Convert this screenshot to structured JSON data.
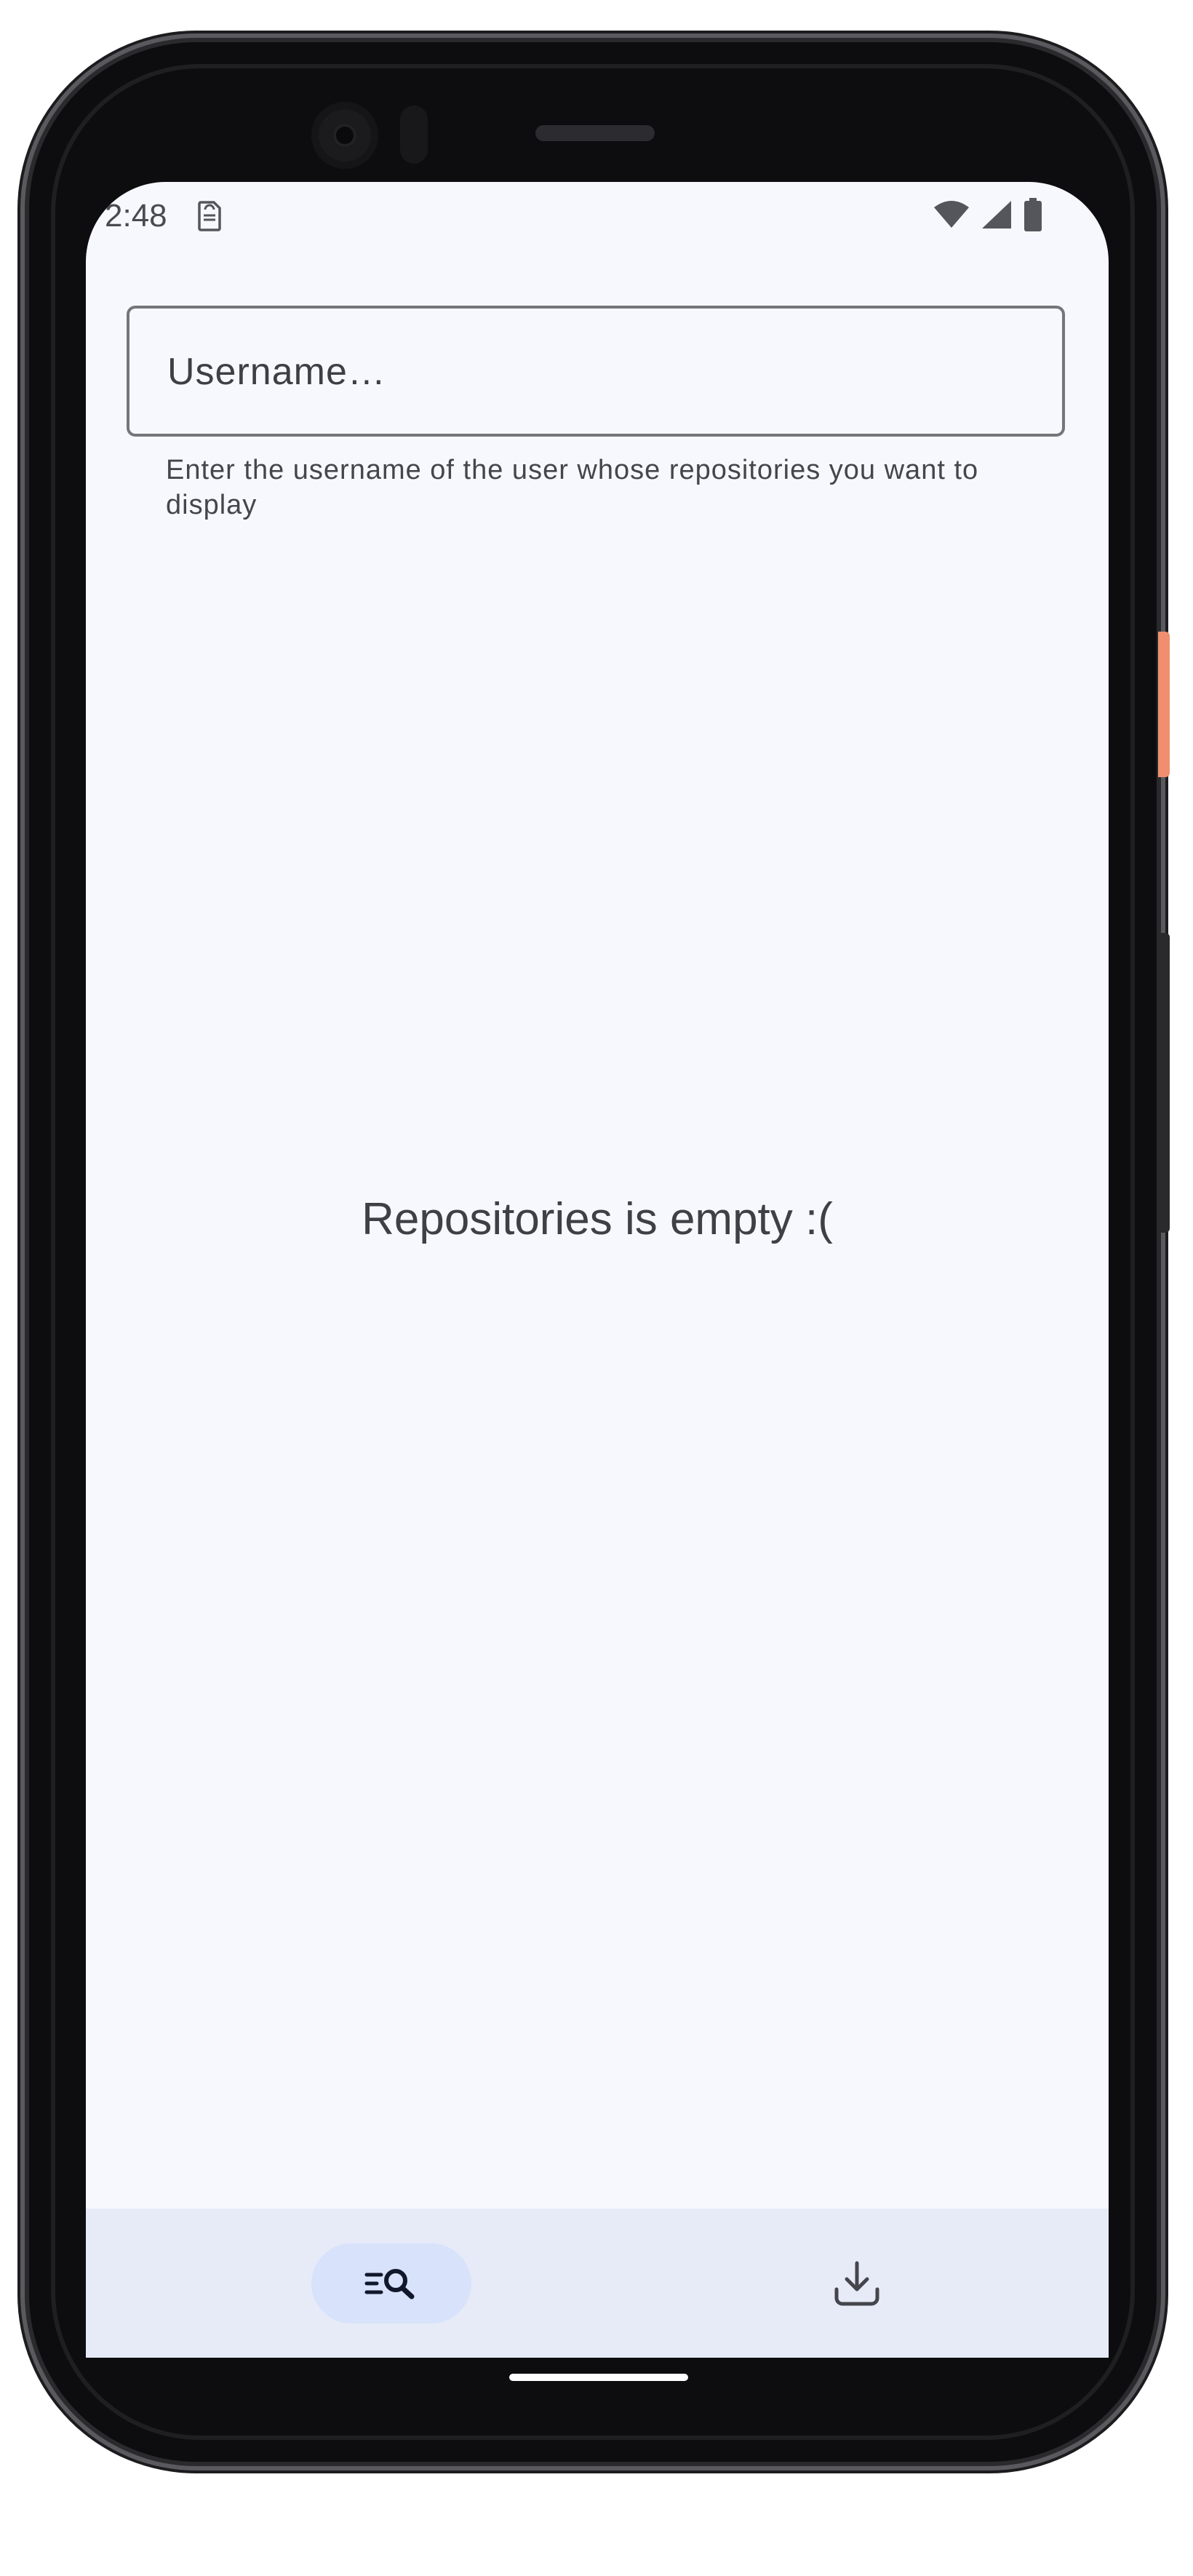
{
  "status_bar": {
    "time": "2:48",
    "sim_icon": "sim-card-alert-icon",
    "wifi_icon": "wifi-icon",
    "signal_icon": "cellular-signal-icon",
    "battery_icon": "battery-icon"
  },
  "search": {
    "placeholder": "Username…",
    "value": "",
    "helper_text": "Enter the username of the user whose repositories you want to display"
  },
  "main": {
    "empty_message": "Repositories is empty :("
  },
  "bottom_nav": {
    "items": [
      {
        "icon": "search-list-icon",
        "selected": true
      },
      {
        "icon": "download-icon",
        "selected": false
      }
    ]
  },
  "colors": {
    "screen_background": "#f7f8fd",
    "nav_background": "#e6ebf7",
    "nav_selected_pill": "#d8e2fb",
    "text_primary": "#3f4045",
    "field_border": "#74767c"
  }
}
